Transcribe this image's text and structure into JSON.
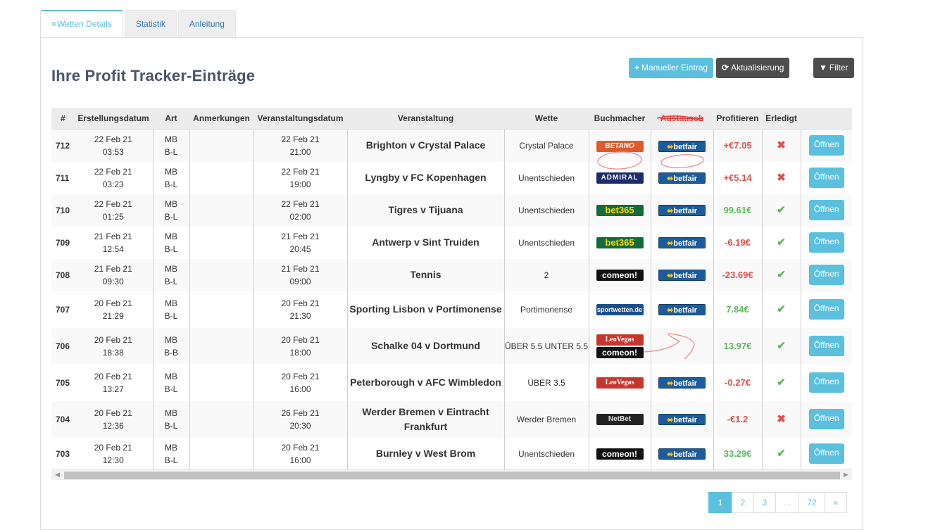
{
  "tabs": [
    {
      "label": "Wetten Details",
      "icon": "list-icon",
      "active": true
    },
    {
      "label": "Statistik",
      "active": false
    },
    {
      "label": "Anleitung",
      "active": false
    }
  ],
  "page_title": "Ihre Profit Tracker-Einträge",
  "toolbar": {
    "manual_label": "Manueller Eintrag",
    "manual_icon": "+",
    "refresh_label": "Aktualisierung",
    "refresh_icon": "⟳",
    "filter_label": "Filter",
    "filter_icon": "▼"
  },
  "table": {
    "headers": [
      "#",
      "Erstellungsdatum",
      "Art",
      "Anmerkungen",
      "Veranstaltungsdatum",
      "Veranstaltung",
      "Wette",
      "Buchmacher",
      "Austausch",
      "Profitieren",
      "Erledigt",
      ""
    ],
    "open_label": "Öffnen",
    "rows": [
      {
        "id": "712",
        "created_date": "22 Feb 21",
        "created_time": "03:53",
        "type1": "MB",
        "type2": "B-L",
        "notes": "",
        "event_date": "22 Feb 21",
        "event_time": "21:00",
        "event": "Brighton v Crystal Palace",
        "bet": "Crystal Palace",
        "bookmakers": [
          "BETANO"
        ],
        "exchange": "betfair",
        "profit": "+€7.05",
        "profit_color": "#d9534f",
        "done": false
      },
      {
        "id": "711",
        "created_date": "22 Feb 21",
        "created_time": "03:23",
        "type1": "MB",
        "type2": "B-L",
        "notes": "",
        "event_date": "22 Feb 21",
        "event_time": "19:00",
        "event": "Lyngby v FC Kopenhagen",
        "bet": "Unentschieden",
        "bookmakers": [
          "ADMIRAL"
        ],
        "exchange": "betfair",
        "profit": "+€5.14",
        "profit_color": "#d9534f",
        "done": false
      },
      {
        "id": "710",
        "created_date": "22 Feb 21",
        "created_time": "01:25",
        "type1": "MB",
        "type2": "B-L",
        "notes": "",
        "event_date": "22 Feb 21",
        "event_time": "02:00",
        "event": "Tigres v Tijuana",
        "bet": "Unentschieden",
        "bookmakers": [
          "bet365"
        ],
        "exchange": "betfair",
        "profit": "99.61€",
        "profit_color": "#5cb85c",
        "done": true
      },
      {
        "id": "709",
        "created_date": "21 Feb 21",
        "created_time": "12:54",
        "type1": "MB",
        "type2": "B-L",
        "notes": "",
        "event_date": "21 Feb 21",
        "event_time": "20:45",
        "event": "Antwerp v Sint Truiden",
        "bet": "Unentschieden",
        "bookmakers": [
          "bet365"
        ],
        "exchange": "betfair",
        "profit": "-6.19€",
        "profit_color": "#d9534f",
        "done": true
      },
      {
        "id": "708",
        "created_date": "21 Feb 21",
        "created_time": "09:30",
        "type1": "MB",
        "type2": "B-L",
        "notes": "",
        "event_date": "21 Feb 21",
        "event_time": "09:00",
        "event": "Tennis",
        "bet": "2",
        "bookmakers": [
          "comeon!"
        ],
        "exchange": "betfair",
        "profit": "-23.69€",
        "profit_color": "#d9534f",
        "done": true
      },
      {
        "id": "707",
        "created_date": "20 Feb 21",
        "created_time": "21:29",
        "type1": "MB",
        "type2": "B-L",
        "notes": "",
        "event_date": "20 Feb 21",
        "event_time": "21:30",
        "event": "Sporting Lisbon v Portimonense",
        "bet": "Portimonense",
        "bookmakers": [
          "sportwetten.de"
        ],
        "exchange": "betfair",
        "profit": "7.84€",
        "profit_color": "#5cb85c",
        "done": true
      },
      {
        "id": "706",
        "created_date": "20 Feb 21",
        "created_time": "18:38",
        "type1": "MB",
        "type2": "B-B",
        "notes": "",
        "event_date": "20 Feb 21",
        "event_time": "18:00",
        "event": "Schalke 04 v Dortmund",
        "bet": "ÜBER 5.5 UNTER 5.5",
        "bookmakers": [
          "LeoVegas",
          "comeon!"
        ],
        "exchange": "",
        "profit": "13.97€",
        "profit_color": "#5cb85c",
        "done": true
      },
      {
        "id": "705",
        "created_date": "20 Feb 21",
        "created_time": "13:27",
        "type1": "MB",
        "type2": "B-L",
        "notes": "",
        "event_date": "20 Feb 21",
        "event_time": "16:00",
        "event": "Peterborough v AFC Wimbledon",
        "bet": "ÜBER 3.5",
        "bookmakers": [
          "LeoVegas"
        ],
        "exchange": "betfair",
        "profit": "-0.27€",
        "profit_color": "#d9534f",
        "done": true
      },
      {
        "id": "704",
        "created_date": "20 Feb 21",
        "created_time": "12:36",
        "type1": "MB",
        "type2": "B-L",
        "notes": "",
        "event_date": "26 Feb 21",
        "event_time": "20:30",
        "event": "Werder Bremen v Eintracht Frankfurt",
        "bet": "Werder Bremen",
        "bookmakers": [
          "NetBet"
        ],
        "exchange": "betfair",
        "profit": "-€1.2",
        "profit_color": "#d9534f",
        "done": false
      },
      {
        "id": "703",
        "created_date": "20 Feb 21",
        "created_time": "12:30",
        "type1": "MB",
        "type2": "B-L",
        "notes": "",
        "event_date": "20 Feb 21",
        "event_time": "16:00",
        "event": "Burnley v West Brom",
        "bet": "Unentschieden",
        "bookmakers": [
          "comeon!"
        ],
        "exchange": "betfair",
        "profit": "33.29€",
        "profit_color": "#5cb85c",
        "done": true
      }
    ]
  },
  "pagination": {
    "pages": [
      "1",
      "2",
      "3",
      "…",
      "72",
      "»"
    ],
    "active": "1"
  },
  "colors": {
    "accent": "#5bc0de",
    "dark_button": "#4d4d4d",
    "loss": "#d9534f",
    "win": "#5cb85c",
    "annotation": "#e57373"
  }
}
